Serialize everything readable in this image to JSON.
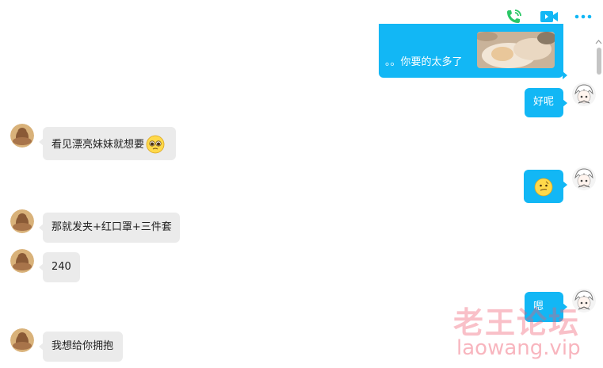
{
  "toolbar": {
    "icons": [
      "phone-icon",
      "video-call-icon",
      "more-dots-icon"
    ],
    "accent_colors": {
      "phone": "#2bc766",
      "video": "#12b7f5",
      "more": "#12b7f5"
    }
  },
  "colors": {
    "outgoing_bubble": "#12b7f5",
    "incoming_bubble": "#ebebeb",
    "watermark": "#f05a6e"
  },
  "messages": [
    {
      "direction": "outgoing",
      "text": "。。你要的太多了",
      "has_image": true
    },
    {
      "direction": "outgoing",
      "text": "好呢"
    },
    {
      "direction": "incoming",
      "text": "看见漂亮妹妹就想要",
      "emoji": "pleading-face-emoji"
    },
    {
      "direction": "outgoing",
      "text": "",
      "emoji": "thinking-face-emoji"
    },
    {
      "direction": "incoming",
      "text": "那就发夹+红口罩+三件套"
    },
    {
      "direction": "incoming",
      "text": "240"
    },
    {
      "direction": "outgoing",
      "text": "嗯"
    },
    {
      "direction": "incoming",
      "text": "我想给你拥抱"
    }
  ],
  "watermark": {
    "title": "老王论坛",
    "url": "laowang.vip"
  }
}
